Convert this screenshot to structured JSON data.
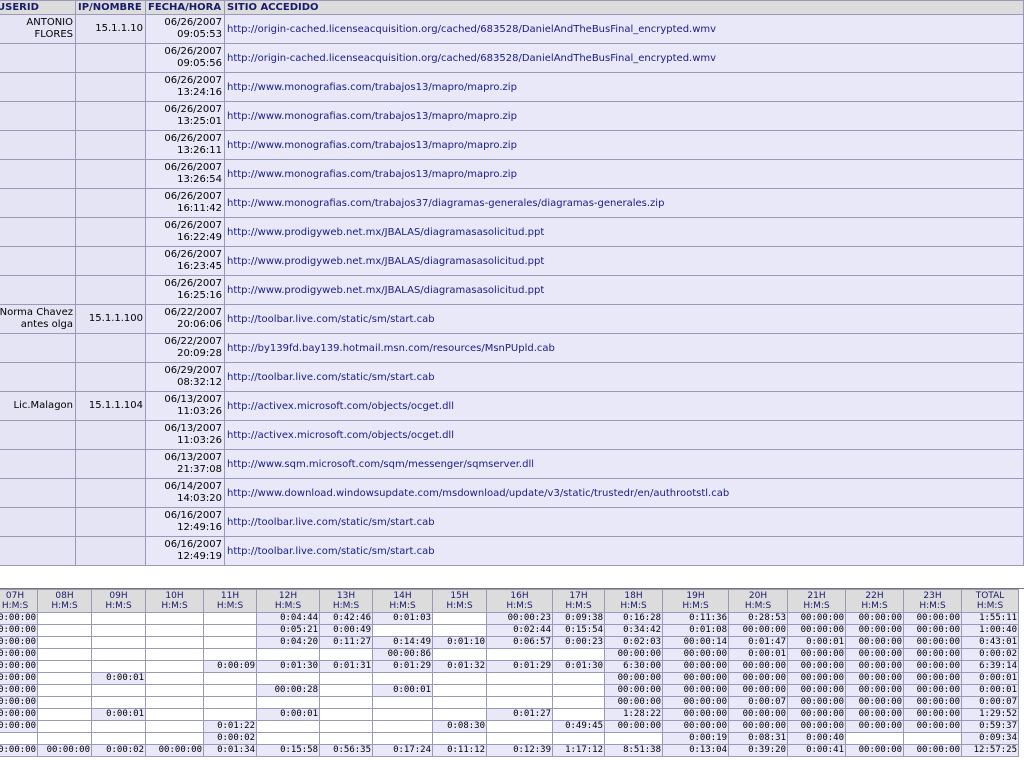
{
  "log": {
    "headers": {
      "userid": "USERID",
      "ip": "IP/NOMBRE",
      "date": "FECHA/HORA",
      "site": "SITIO ACCEDIDO"
    },
    "rows": [
      {
        "user": "ANTONIO FLORES",
        "ip": "15.1.1.10",
        "date": "06/26/2007",
        "time": "09:05:53",
        "url": "http://origin-cached.licenseacquisition.org/cached/683528/DanielAndTheBusFinal_encrypted.wmv"
      },
      {
        "user": "",
        "ip": "",
        "date": "06/26/2007",
        "time": "09:05:56",
        "url": "http://origin-cached.licenseacquisition.org/cached/683528/DanielAndTheBusFinal_encrypted.wmv"
      },
      {
        "user": "",
        "ip": "",
        "date": "06/26/2007",
        "time": "13:24:16",
        "url": "http://www.monografias.com/trabajos13/mapro/mapro.zip"
      },
      {
        "user": "",
        "ip": "",
        "date": "06/26/2007",
        "time": "13:25:01",
        "url": "http://www.monografias.com/trabajos13/mapro/mapro.zip"
      },
      {
        "user": "",
        "ip": "",
        "date": "06/26/2007",
        "time": "13:26:11",
        "url": "http://www.monografias.com/trabajos13/mapro/mapro.zip"
      },
      {
        "user": "",
        "ip": "",
        "date": "06/26/2007",
        "time": "13:26:54",
        "url": "http://www.monografias.com/trabajos13/mapro/mapro.zip"
      },
      {
        "user": "",
        "ip": "",
        "date": "06/26/2007",
        "time": "16:11:42",
        "url": "http://www.monografias.com/trabajos37/diagramas-generales/diagramas-generales.zip"
      },
      {
        "user": "",
        "ip": "",
        "date": "06/26/2007",
        "time": "16:22:49",
        "url": "http://www.prodigyweb.net.mx/JBALAS/diagramasasolicitud.ppt"
      },
      {
        "user": "",
        "ip": "",
        "date": "06/26/2007",
        "time": "16:23:45",
        "url": "http://www.prodigyweb.net.mx/JBALAS/diagramasasolicitud.ppt"
      },
      {
        "user": "",
        "ip": "",
        "date": "06/26/2007",
        "time": "16:25:16",
        "url": "http://www.prodigyweb.net.mx/JBALAS/diagramasasolicitud.ppt"
      },
      {
        "user": "Norma Chavez antes olga",
        "ip": "15.1.1.100",
        "date": "06/22/2007",
        "time": "20:06:06",
        "url": "http://toolbar.live.com/static/sm/start.cab"
      },
      {
        "user": "",
        "ip": "",
        "date": "06/22/2007",
        "time": "20:09:28",
        "url": "http://by139fd.bay139.hotmail.msn.com/resources/MsnPUpld.cab"
      },
      {
        "user": "",
        "ip": "",
        "date": "06/29/2007",
        "time": "08:32:12",
        "url": "http://toolbar.live.com/static/sm/start.cab"
      },
      {
        "user": "Lic.Malagon",
        "ip": "15.1.1.104",
        "date": "06/13/2007",
        "time": "11:03:26",
        "url": "http://activex.microsoft.com/objects/ocget.dll"
      },
      {
        "user": "",
        "ip": "",
        "date": "06/13/2007",
        "time": "11:03:26",
        "url": "http://activex.microsoft.com/objects/ocget.dll"
      },
      {
        "user": "",
        "ip": "",
        "date": "06/13/2007",
        "time": "21:37:08",
        "url": "http://www.sqm.microsoft.com/sqm/messenger/sqmserver.dll"
      },
      {
        "user": "",
        "ip": "",
        "date": "06/14/2007",
        "time": "14:03:20",
        "url": "http://www.download.windowsupdate.com/msdownload/update/v3/static/trustedr/en/authrootstl.cab"
      },
      {
        "user": "",
        "ip": "",
        "date": "06/16/2007",
        "time": "12:49:16",
        "url": "http://toolbar.live.com/static/sm/start.cab"
      },
      {
        "user": "",
        "ip": "",
        "date": "06/16/2007",
        "time": "12:49:19",
        "url": "http://toolbar.live.com/static/sm/start.cab"
      }
    ]
  },
  "hours": {
    "columns": [
      {
        "hour": "07H",
        "sub": "H:M:S"
      },
      {
        "hour": "08H",
        "sub": "H:M:S"
      },
      {
        "hour": "09H",
        "sub": "H:M:S"
      },
      {
        "hour": "10H",
        "sub": "H:M:S"
      },
      {
        "hour": "11H",
        "sub": "H:M:S"
      },
      {
        "hour": "12H",
        "sub": "H:M:S"
      },
      {
        "hour": "13H",
        "sub": "H:M:S"
      },
      {
        "hour": "14H",
        "sub": "H:M:S"
      },
      {
        "hour": "15H",
        "sub": "H:M:S"
      },
      {
        "hour": "16H",
        "sub": "H:M:S"
      },
      {
        "hour": "17H",
        "sub": "H:M:S"
      },
      {
        "hour": "18H",
        "sub": "H:M:S"
      },
      {
        "hour": "19H",
        "sub": "H:M:S"
      },
      {
        "hour": "20H",
        "sub": "H:M:S"
      },
      {
        "hour": "21H",
        "sub": "H:M:S"
      },
      {
        "hour": "22H",
        "sub": "H:M:S"
      },
      {
        "hour": "23H",
        "sub": "H:M:S"
      },
      {
        "hour": "TOTAL",
        "sub": "H:M:S"
      }
    ],
    "rows": [
      [
        "0:00:00",
        "",
        "",
        "",
        "",
        "0:04:44",
        "0:42:46",
        "0:01:03",
        "",
        "00:00:23",
        "0:09:38",
        "0:16:28",
        "0:11:36",
        "0:28:53",
        "00:00:00",
        "00:00:00",
        "00:00:00",
        "1:55:11"
      ],
      [
        "0:00:00",
        "",
        "",
        "",
        "",
        "0:05:21",
        "0:00:49",
        "",
        "",
        "0:02:44",
        "0:15:54",
        "0:34:42",
        "0:01:08",
        "00:00:00",
        "00:00:00",
        "00:00:00",
        "00:00:00",
        "1:00:40"
      ],
      [
        "0:00:00",
        "",
        "",
        "",
        "",
        "0:04:20",
        "0:11:27",
        "0:14:49",
        "0:01:10",
        "0:06:57",
        "0:00:23",
        "0:02:03",
        "00:00:14",
        "0:01:47",
        "0:00:01",
        "00:00:00",
        "00:00:00",
        "0:43:01"
      ],
      [
        "0:00:00",
        "",
        "",
        "",
        "",
        "",
        "",
        "00:00:86",
        "",
        "",
        "",
        "00:00:00",
        "00:00:00",
        "0:00:01",
        "00:00:00",
        "00:00:00",
        "00:00:00",
        "0:00:02"
      ],
      [
        "0:00:00",
        "",
        "",
        "",
        "0:00:09",
        "0:01:30",
        "0:01:31",
        "0:01:29",
        "0:01:32",
        "0:01:29",
        "0:01:30",
        "6:30:00",
        "00:00:00",
        "00:00:00",
        "00:00:00",
        "00:00:00",
        "00:00:00",
        "6:39:14"
      ],
      [
        "0:00:00",
        "",
        "0:00:01",
        "",
        "",
        "",
        "",
        "",
        "",
        "",
        "",
        "00:00:00",
        "00:00:00",
        "00:00:00",
        "00:00:00",
        "00:00:00",
        "00:00:00",
        "0:00:01"
      ],
      [
        "0:00:00",
        "",
        "",
        "",
        "",
        "00:00:28",
        "",
        "0:00:01",
        "",
        "",
        "",
        "00:00:00",
        "00:00:00",
        "00:00:00",
        "00:00:00",
        "00:00:00",
        "00:00:00",
        "0:00:01"
      ],
      [
        "0:00:00",
        "",
        "",
        "",
        "",
        "",
        "",
        "",
        "",
        "",
        "",
        "00:00:00",
        "00:00:00",
        "0:00:07",
        "00:00:00",
        "00:00:00",
        "00:00:00",
        "0:00:07"
      ],
      [
        "0:00:00",
        "",
        "0:00:01",
        "",
        "",
        "0:00:01",
        "",
        "",
        "",
        "0:01:27",
        "",
        "1:28:22",
        "00:00:00",
        "00:00:00",
        "00:00:00",
        "00:00:00",
        "00:00:00",
        "1:29:52"
      ],
      [
        "0:00:00",
        "",
        "",
        "",
        "0:01:22",
        "",
        "",
        "",
        "0:08:30",
        "",
        "0:49:45",
        "00:00:00",
        "00:00:00",
        "00:00:00",
        "00:00:00",
        "00:00:00",
        "00:00:00",
        "0:59:37"
      ],
      [
        "",
        "",
        "",
        "",
        "0:00:02",
        "",
        "",
        "",
        "",
        "",
        "",
        "",
        "0:00:19",
        "0:08:31",
        "0:00:40",
        "",
        "",
        "0:09:34"
      ]
    ],
    "total_row": [
      "0:00:00",
      "00:00:00",
      "0:00:02",
      "00:00:00",
      "0:01:34",
      "0:15:58",
      "0:56:35",
      "0:17:24",
      "0:11:12",
      "0:12:39",
      "1:17:12",
      "8:51:38",
      "0:13:04",
      "0:39:20",
      "0:00:41",
      "00:00:00",
      "00:00:00",
      "12:57:25"
    ]
  }
}
